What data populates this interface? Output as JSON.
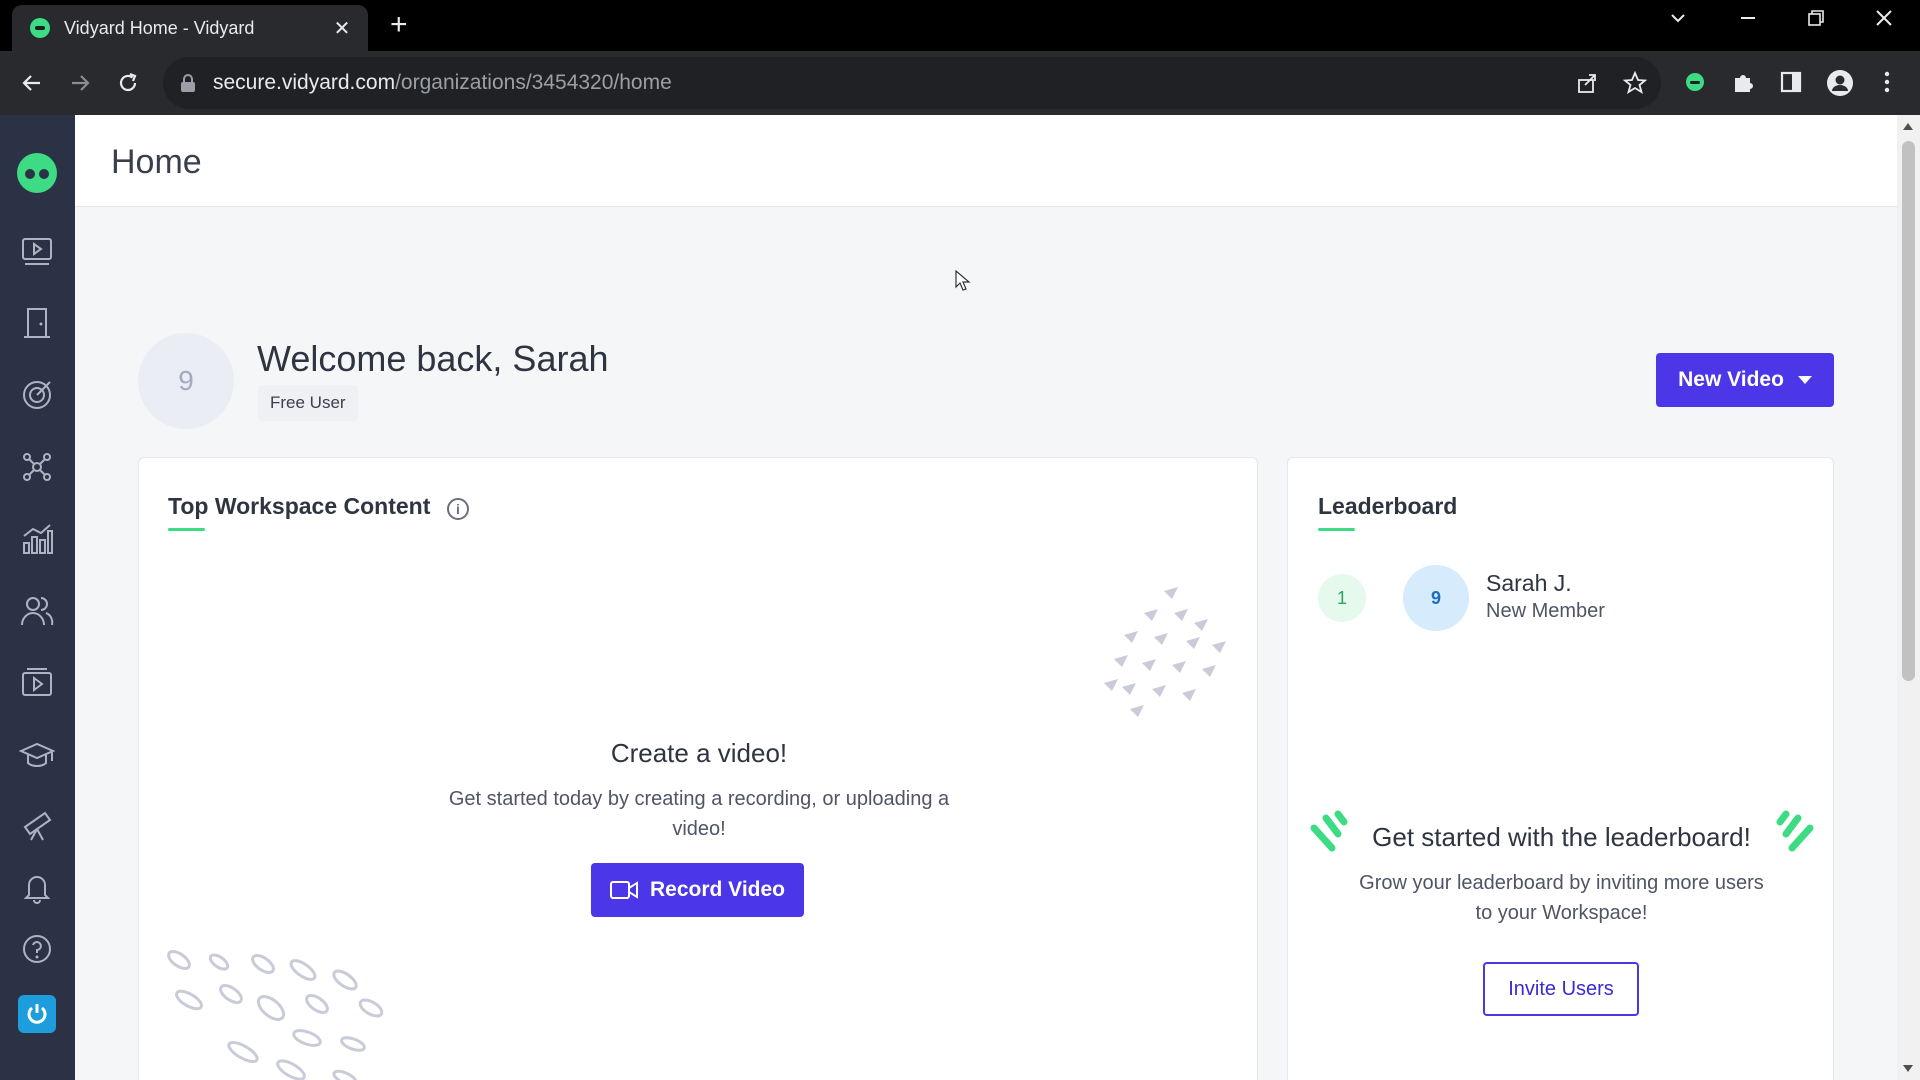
{
  "browser": {
    "tab_title": "Vidyard Home - Vidyard",
    "url_host": "secure.vidyard.com",
    "url_path": "/organizations/3454320/home"
  },
  "header": {
    "title": "Home"
  },
  "welcome": {
    "avatar_initial": "9",
    "greeting": "Welcome back, Sarah",
    "badge": "Free User",
    "new_video_label": "New Video"
  },
  "workspace_card": {
    "title": "Top Workspace Content",
    "empty_title": "Create a video!",
    "empty_text": "Get started today by creating a recording, or uploading a video!",
    "record_label": "Record Video"
  },
  "leaderboard": {
    "title": "Leaderboard",
    "entries": [
      {
        "rank": "1",
        "avatar": "9",
        "name": "Sarah J.",
        "role": "New Member"
      }
    ],
    "cta_title": "Get started with the leaderboard!",
    "cta_text": "Grow your leaderboard by inviting more users to your Workspace!",
    "invite_label": "Invite Users"
  },
  "colors": {
    "accent": "#4b36e8",
    "brand_green": "#3ddc84",
    "sidebar": "#2b3245"
  },
  "icons": [
    "home-icon",
    "video-library-icon",
    "door-icon",
    "target-icon",
    "integrations-icon",
    "analytics-icon",
    "users-icon",
    "playlist-icon",
    "learn-icon",
    "telescope-icon",
    "bell-icon",
    "help-icon",
    "power-icon"
  ]
}
